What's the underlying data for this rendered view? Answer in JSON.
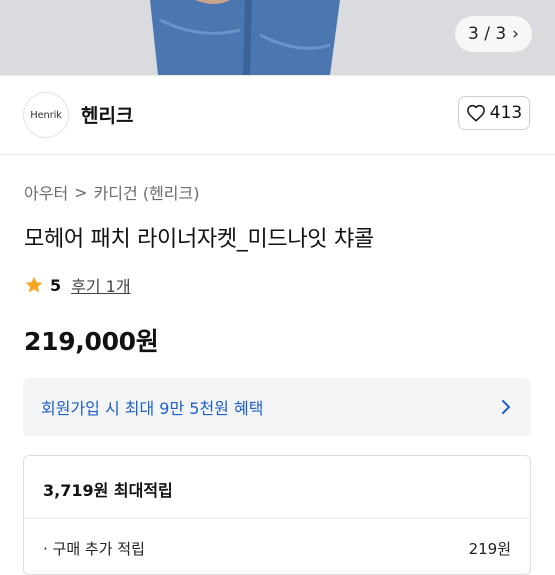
{
  "gallery": {
    "counter": "3 / 3"
  },
  "brand": {
    "logo_text": "Henrik",
    "name": "헨리크",
    "likes": "413"
  },
  "breadcrumb": {
    "category": "아우터",
    "subcategory": "카디건 (헨리크)"
  },
  "product": {
    "title": "모헤어 패치 라이너자켓_미드나잇 챠콜",
    "rating": "5",
    "reviews": "후기 1개",
    "price": "219,000원"
  },
  "promo": {
    "text": "회원가입 시 최대 9만 5천원 혜택"
  },
  "points": {
    "title": "3,719원 최대적립",
    "rows": [
      {
        "label": "· 구매 추가 적립",
        "value": "219원"
      }
    ]
  },
  "colors": {
    "accent_blue": "#1f5fc8",
    "star": "#f5a623",
    "denim": "#4a77b0"
  }
}
